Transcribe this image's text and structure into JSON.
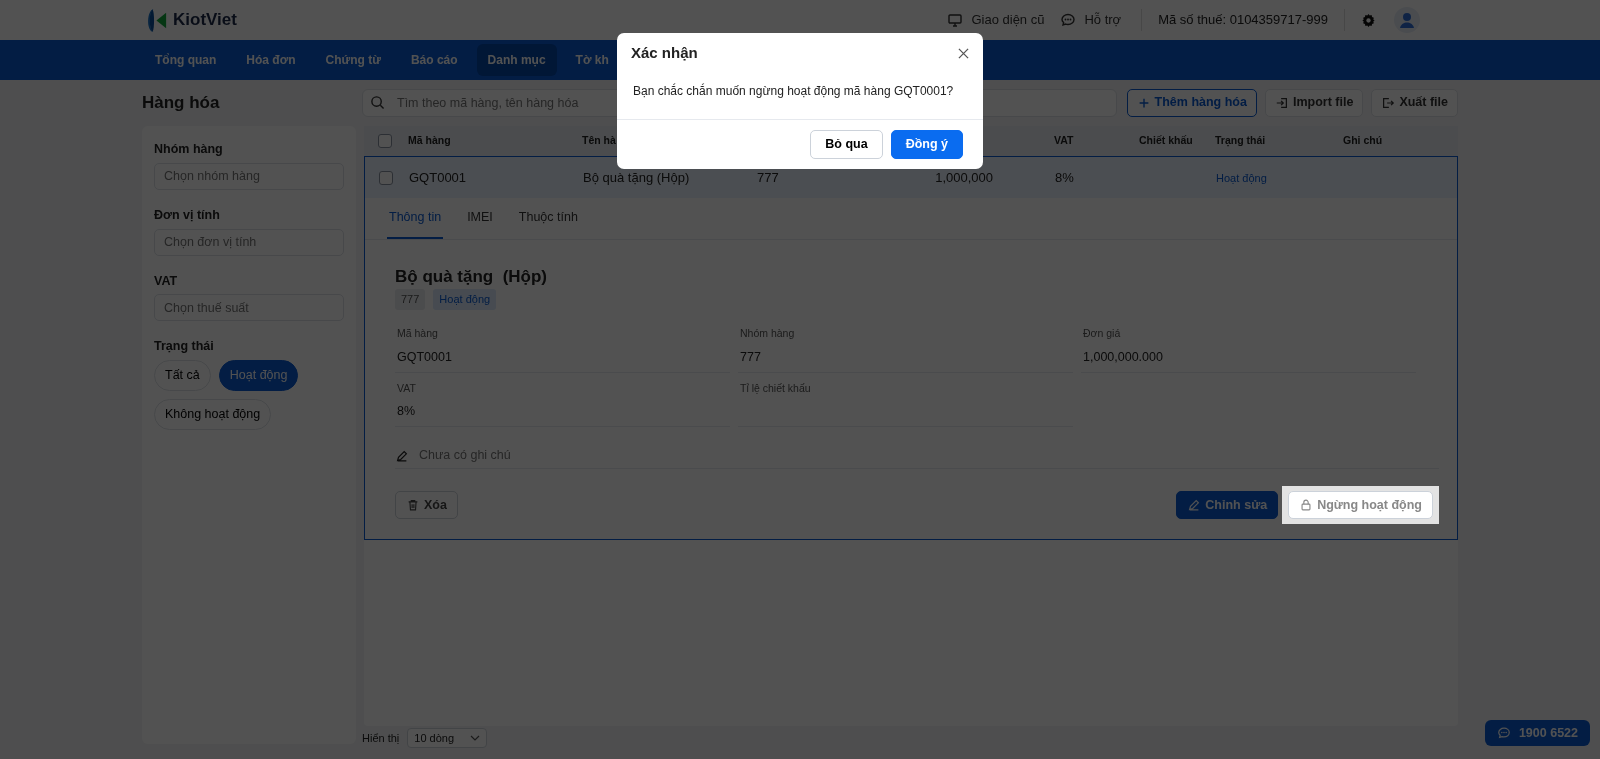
{
  "header": {
    "logo": "KiotViet",
    "links": [
      {
        "label": "Giao diện cũ"
      },
      {
        "label": "Hỗ trợ"
      }
    ],
    "tax_code": "Mã số thuế: 0104359717-999"
  },
  "nav": [
    {
      "label": "Tổng quan",
      "selected": false
    },
    {
      "label": "Hóa đơn",
      "selected": false
    },
    {
      "label": "Chứng từ",
      "selected": false
    },
    {
      "label": "Báo cáo",
      "selected": false
    },
    {
      "label": "Danh mục",
      "selected": true
    },
    {
      "label": "Tờ kh",
      "selected": false
    }
  ],
  "page_title": "Hàng hóa",
  "filters": [
    {
      "label": "Nhóm hàng",
      "placeholder": "Chọn nhóm hàng"
    },
    {
      "label": "Đơn vị tính",
      "placeholder": "Chọn đơn vị tính"
    },
    {
      "label": "VAT",
      "placeholder": "Chọn thuế suất"
    }
  ],
  "status_filter": {
    "label": "Trạng thái",
    "options": [
      {
        "label": "Tất cả",
        "selected": false
      },
      {
        "label": "Hoạt động",
        "selected": true
      },
      {
        "label": "Không hoạt động",
        "selected": false
      }
    ]
  },
  "search": {
    "placeholder": "Tìm theo mã hàng, tên hàng hóa"
  },
  "actions": [
    {
      "label": "Thêm hàng hóa",
      "kind": "add"
    },
    {
      "label": "Import file",
      "kind": "import"
    },
    {
      "label": "Xuất file",
      "kind": "export"
    }
  ],
  "table": {
    "header_checked": false,
    "columns": [
      "Mã hàng",
      "Tên hà",
      "VAT",
      "Chiết khấu",
      "Trạng thái",
      "Ghi chú"
    ],
    "rows": [
      {
        "checked": false,
        "selected": true,
        "expanded": true,
        "code": "GQT0001",
        "name": "Bộ quà tặng (Hộp)",
        "group": "777",
        "price": "1,000,000",
        "vat": "8%",
        "status": "Hoạt động"
      }
    ]
  },
  "detail": {
    "tabs": [
      {
        "label": "Thông tin",
        "selected": true
      },
      {
        "label": "IMEI",
        "selected": false
      },
      {
        "label": "Thuộc tính",
        "selected": false
      }
    ],
    "title": "Bộ quà tặng  (Hộp)",
    "tags": [
      {
        "label": "777",
        "kind": "group"
      },
      {
        "label": "Hoạt động",
        "kind": "status"
      }
    ],
    "fields": [
      {
        "label": "Mã hàng",
        "value": "GQT0001"
      },
      {
        "label": "Nhóm hàng",
        "value": "777"
      },
      {
        "label": "Đơn giá",
        "value": "1,000,000.000"
      },
      {
        "label": "VAT",
        "value": "8%"
      },
      {
        "label": "Tỉ lệ chiết khấu"
      }
    ],
    "note": {
      "placeholder": "Chưa có ghi chú"
    },
    "buttons": [
      {
        "label": "Xóa",
        "kind": "delete",
        "spotlight": false
      },
      {
        "label": "Chỉnh sửa",
        "kind": "edit",
        "spotlight": false
      },
      {
        "label": "Ngừng hoạt động",
        "kind": "deactivate",
        "spotlight": true
      }
    ]
  },
  "footer": {
    "label": "Hiển thị",
    "page_size": "10 dòng"
  },
  "hotline": "1900 6522",
  "modal": {
    "title": "Xác nhận",
    "message": "Bạn chắc chắn muốn ngừng hoạt động mã hàng GQT0001?",
    "buttons": [
      {
        "label": "Bỏ qua",
        "kind": "secondary"
      },
      {
        "label": "Đồng ý",
        "kind": "primary"
      }
    ]
  }
}
